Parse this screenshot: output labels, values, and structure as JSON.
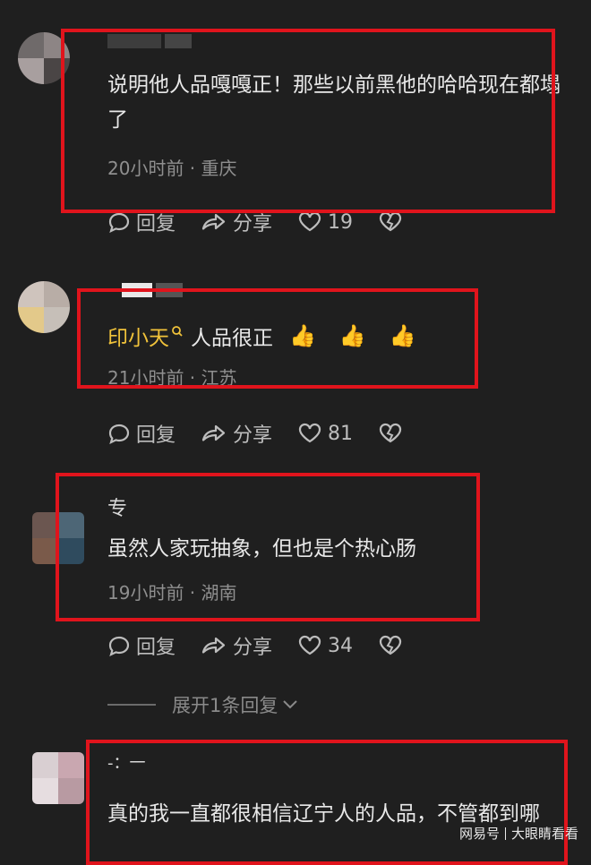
{
  "comments": [
    {
      "author": "",
      "text": "说明他人品嘎嘎正！那些以前黑他的哈哈现在都塌了",
      "meta": "20小时前 · 重庆",
      "reply_label": "回复",
      "share_label": "分享",
      "likes": "19"
    },
    {
      "author": "印小天",
      "text": "人品很正",
      "emojis": [
        "👍",
        "👍",
        "👍"
      ],
      "meta": "21小时前 · 江苏",
      "reply_label": "回复",
      "share_label": "分享",
      "likes": "81"
    },
    {
      "author": "专",
      "text": "虽然人家玩抽象，但也是个热心肠",
      "meta": "19小时前 · 湖南",
      "reply_label": "回复",
      "share_label": "分享",
      "likes": "34"
    },
    {
      "author": "-：一",
      "text": "真的我一直都很相信辽宁人的人品，不管都到哪"
    }
  ],
  "expand_label": "展开1条回复",
  "watermark": {
    "left": "网易号",
    "right": "大眼睛看看"
  },
  "colors": {
    "background": "#1f1f1f",
    "highlight_box": "#e0141c",
    "gold_name": "#f0c23a"
  }
}
